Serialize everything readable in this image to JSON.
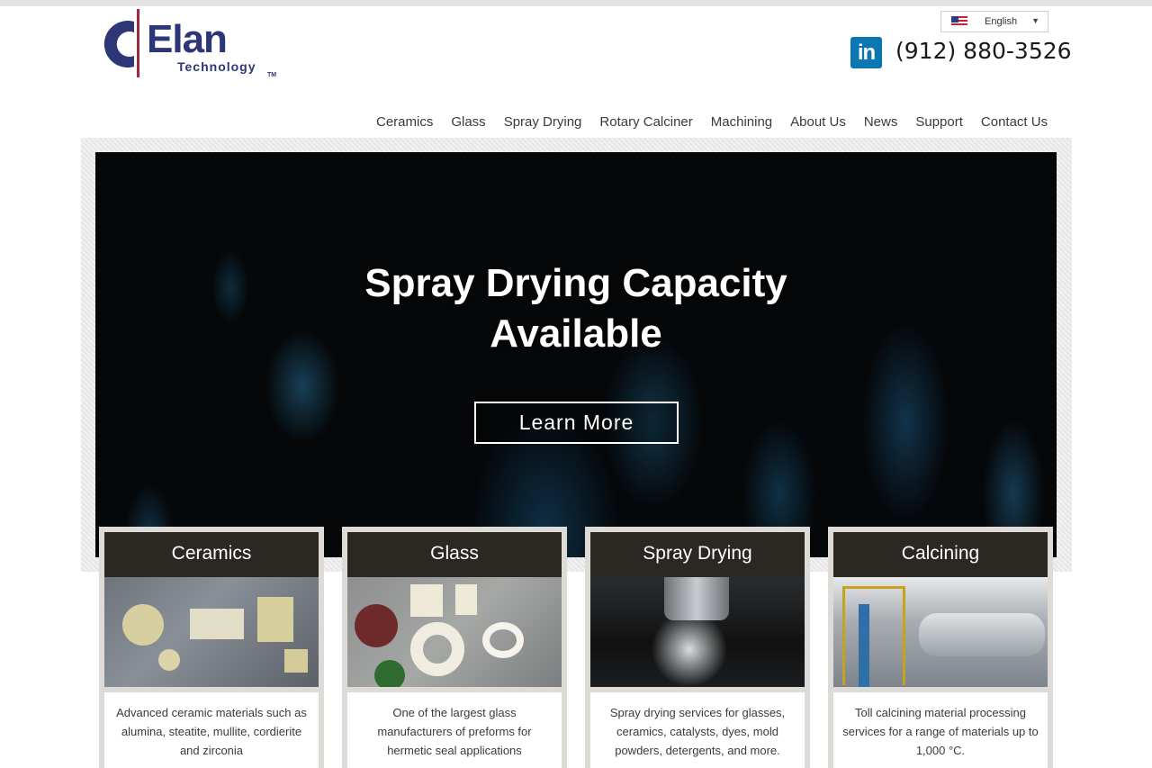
{
  "header": {
    "logo_word": "Elan",
    "logo_sub": "Technology",
    "logo_tm": "TM",
    "language": "English",
    "phone": "(912) 880-3526",
    "linkedin_label": "in"
  },
  "nav": {
    "items": [
      {
        "label": "Ceramics"
      },
      {
        "label": "Glass"
      },
      {
        "label": "Spray Drying"
      },
      {
        "label": "Rotary Calciner"
      },
      {
        "label": "Machining"
      },
      {
        "label": "About Us"
      },
      {
        "label": "News"
      },
      {
        "label": "Support"
      },
      {
        "label": "Contact Us"
      }
    ]
  },
  "hero": {
    "title_line1": "Spray Drying Capacity",
    "title_line2": "Available",
    "button_label": "Learn More"
  },
  "cards": [
    {
      "title": "Ceramics",
      "description": "Advanced ceramic materials such as alumina, steatite, mullite, cordierite and zirconia"
    },
    {
      "title": "Glass",
      "description": "One of the largest glass manufacturers of preforms for hermetic seal applications"
    },
    {
      "title": "Spray  Drying",
      "description": "Spray drying services for glasses, ceramics, catalysts, dyes, mold powders, detergents, and more."
    },
    {
      "title": "Calcining",
      "description": "Toll calcining material processing services for a range of materials up to 1,000 °C."
    }
  ],
  "colors": {
    "brand": "#2d3676",
    "accent": "#9b2a3a",
    "linkedin": "#0a76b2",
    "card_header": "#2b2824"
  }
}
